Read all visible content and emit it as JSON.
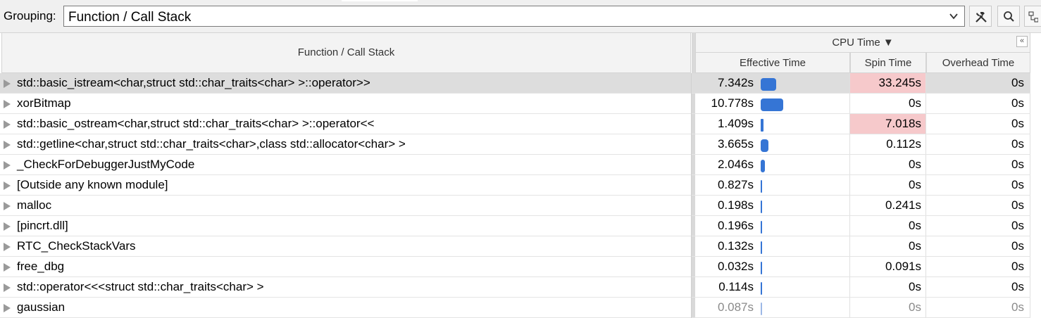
{
  "toolbar": {
    "grouping_label": "Grouping:",
    "grouping_value": "Function / Call Stack"
  },
  "columns": {
    "function": "Function / Call Stack",
    "cpu_time": "CPU Time ▼",
    "collapse": "«",
    "effective": "Effective Time",
    "spin": "Spin Time",
    "overhead": "Overhead Time"
  },
  "rows": [
    {
      "fn": "std::basic_istream<char,struct std::char_traits<char> >::operator>>",
      "eff": "7.342s",
      "eff_value": 7.342,
      "spin": "33.245s",
      "spin_hot": true,
      "ovh": "0s",
      "selected": true
    },
    {
      "fn": "xorBitmap",
      "eff": "10.778s",
      "eff_value": 10.778,
      "spin": "0s",
      "spin_hot": false,
      "ovh": "0s"
    },
    {
      "fn": "std::basic_ostream<char,struct std::char_traits<char> >::operator<<",
      "eff": "1.409s",
      "eff_value": 1.409,
      "spin": "7.018s",
      "spin_hot": true,
      "ovh": "0s"
    },
    {
      "fn": "std::getline<char,struct std::char_traits<char>,class std::allocator<char> >",
      "eff": "3.665s",
      "eff_value": 3.665,
      "spin": "0.112s",
      "spin_hot": false,
      "ovh": "0s"
    },
    {
      "fn": "_CheckForDebuggerJustMyCode",
      "eff": "2.046s",
      "eff_value": 2.046,
      "spin": "0s",
      "spin_hot": false,
      "ovh": "0s"
    },
    {
      "fn": "[Outside any known module]",
      "eff": "0.827s",
      "eff_value": 0.827,
      "spin": "0s",
      "spin_hot": false,
      "ovh": "0s"
    },
    {
      "fn": "malloc",
      "eff": "0.198s",
      "eff_value": 0.198,
      "spin": "0.241s",
      "spin_hot": false,
      "ovh": "0s"
    },
    {
      "fn": "[pincrt.dll]",
      "eff": "0.196s",
      "eff_value": 0.196,
      "spin": "0s",
      "spin_hot": false,
      "ovh": "0s"
    },
    {
      "fn": "RTC_CheckStackVars",
      "eff": "0.132s",
      "eff_value": 0.132,
      "spin": "0s",
      "spin_hot": false,
      "ovh": "0s"
    },
    {
      "fn": "free_dbg",
      "eff": "0.032s",
      "eff_value": 0.032,
      "spin": "0.091s",
      "spin_hot": false,
      "ovh": "0s"
    },
    {
      "fn": "std::operator<<<struct std::char_traits<char> >",
      "eff": "0.114s",
      "eff_value": 0.114,
      "spin": "0s",
      "spin_hot": false,
      "ovh": "0s"
    },
    {
      "fn": "gaussian",
      "eff": "0.087s",
      "eff_value": 0.087,
      "spin": "0s",
      "spin_hot": false,
      "ovh": "0s",
      "faded": true
    }
  ],
  "colors": {
    "bar": "#3575d5",
    "spin_hot": "#f6c9cb",
    "selected_row": "#dddddd"
  },
  "icons": [
    "chevron-down-icon",
    "tools-icon",
    "search-icon",
    "tree-icon",
    "expand-triangle-icon"
  ]
}
